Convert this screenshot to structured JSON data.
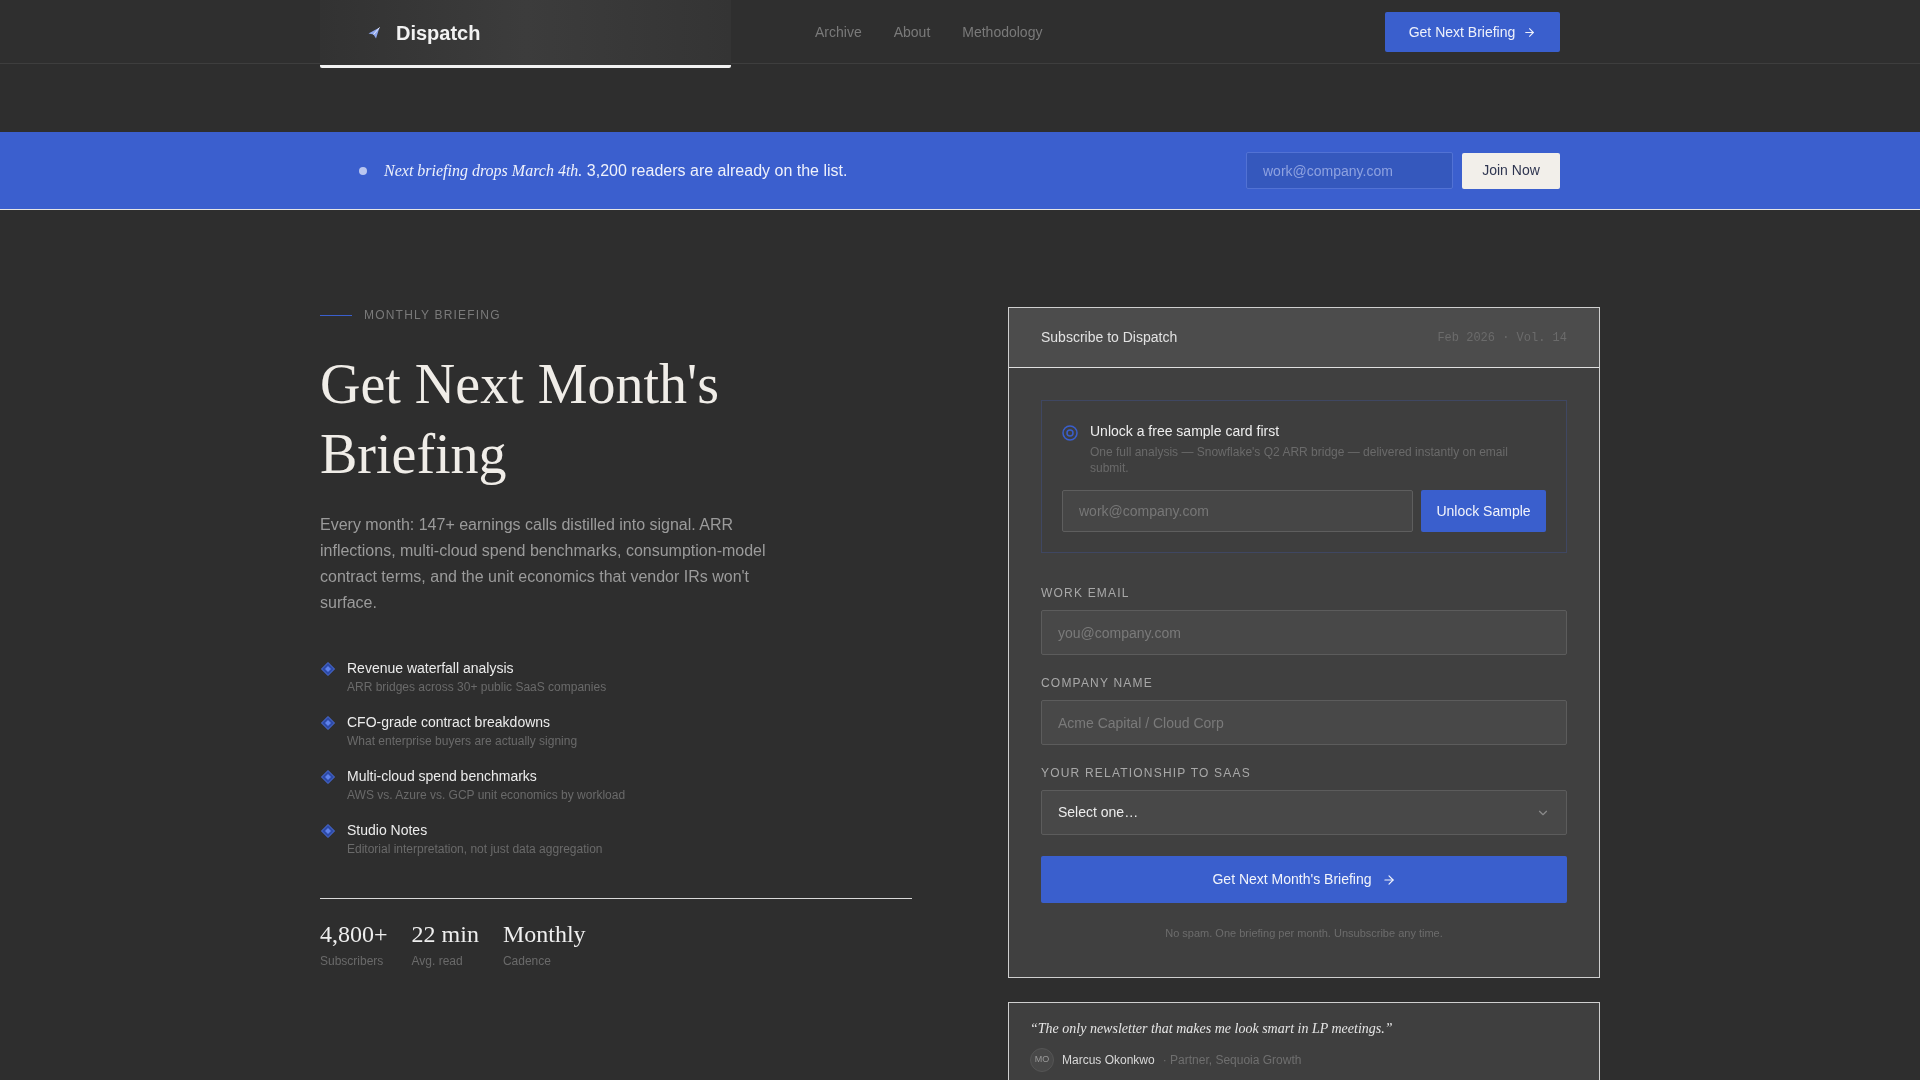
{
  "nav": {
    "brand": "Dispatch",
    "links": [
      {
        "label": "Archive"
      },
      {
        "label": "About"
      },
      {
        "label": "Methodology"
      }
    ],
    "cta": "Get Next Briefing"
  },
  "banner": {
    "message": "*Next briefing drops March 4th.* 3,200 readers are already on the list.",
    "email_placeholder": "work@company.com",
    "button": "Join Now"
  },
  "hero": {
    "eyebrow": "MONTHLY BRIEFING",
    "title": "Get Next Month's Briefing",
    "description": "Every month: 147+ earnings calls distilled into signal. ARR inflections, multi-cloud spend benchmarks, consumption-model contract terms, and the unit economics that vendor IRs won't surface.",
    "features": [
      {
        "title": "Revenue waterfall analysis",
        "subtitle": "ARR bridges across 30+ public SaaS companies"
      },
      {
        "title": "CFO-grade contract breakdowns",
        "subtitle": "What enterprise buyers are actually signing"
      },
      {
        "title": "Multi-cloud spend benchmarks",
        "subtitle": "AWS vs. Azure vs. GCP unit economics by workload"
      },
      {
        "title": "Studio Notes",
        "subtitle": "Editorial interpretation, not just data aggregation"
      }
    ],
    "stats": [
      {
        "value": "4,800+",
        "label": "Subscribers"
      },
      {
        "value": "22 min",
        "label": "Avg. read"
      },
      {
        "value": "Monthly",
        "label": "Cadence"
      }
    ]
  },
  "signup_card": {
    "title": "Subscribe to Dispatch",
    "issue": "Feb 2026 · Vol. 14",
    "sample": {
      "title": "Unlock a free sample card first",
      "description": "One full analysis — Snowflake's Q2 ARR bridge — delivered instantly on email submit.",
      "placeholder": "work@company.com",
      "button": "Unlock Sample"
    },
    "fields": [
      {
        "kind": "input",
        "label": "WORK EMAIL",
        "placeholder": "you@company.com"
      },
      {
        "kind": "input",
        "label": "COMPANY NAME",
        "placeholder": "Acme Capital / Cloud Corp"
      },
      {
        "kind": "select",
        "label": "YOUR RELATIONSHIP TO SAAS",
        "value": "Select one…"
      }
    ],
    "submit": "Get Next Month's Briefing",
    "note": "No spam. One briefing per month. Unsubscribe any time."
  },
  "testimonial": {
    "quote": "“The only newsletter that makes me look smart in LP meetings.”",
    "initials": "MO",
    "name": "Marcus Okonkwo",
    "role": "· Partner, Sequoia Growth"
  }
}
